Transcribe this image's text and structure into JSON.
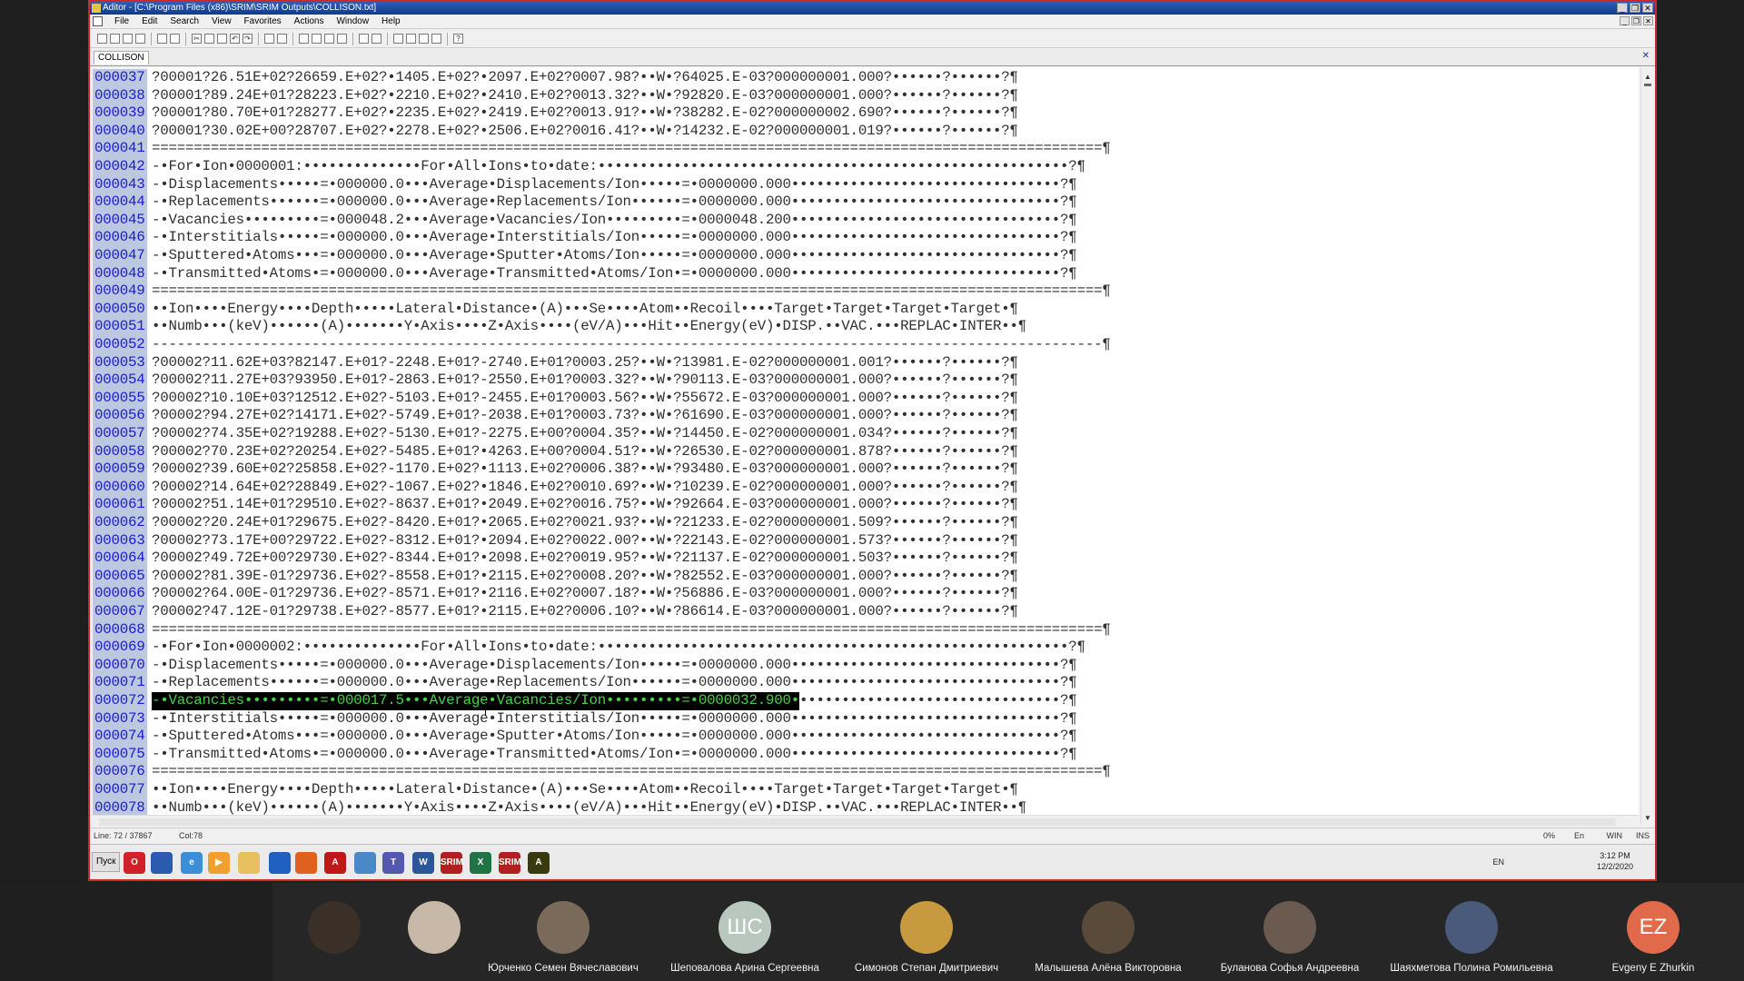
{
  "window": {
    "title": "Aditor - [C:\\Program Files (x86)\\SRIM\\SRIM Outputs\\COLLISON.txt]",
    "controls": [
      "_",
      "❐",
      "✕"
    ]
  },
  "menu": [
    "File",
    "Edit",
    "Search",
    "View",
    "Favorites",
    "Actions",
    "Window",
    "Help"
  ],
  "tab": {
    "label": "COLLISON",
    "close": "✕"
  },
  "editor": {
    "lines": [
      {
        "n": "000037",
        "t": "?00001?26.51E+02?26659.E+02?•1405.E+02?•2097.E+02?0007.98?••W•?64025.E-03?000000001.000?••••••?••••••?¶"
      },
      {
        "n": "000038",
        "t": "?00001?89.24E+01?28223.E+02?•2210.E+02?•2410.E+02?0013.32?••W•?92820.E-03?000000001.000?••••••?••••••?¶"
      },
      {
        "n": "000039",
        "t": "?00001?80.70E+01?28277.E+02?•2235.E+02?•2419.E+02?0013.91?••W•?38282.E-02?000000002.690?••••••?••••••?¶"
      },
      {
        "n": "000040",
        "t": "?00001?30.02E+00?28707.E+02?•2278.E+02?•2506.E+02?0016.41?••W•?14232.E-02?000000001.019?••••••?••••••?¶"
      },
      {
        "n": "000041",
        "t": "=================================================================================================================¶"
      },
      {
        "n": "000042",
        "t": "-•For•Ion•0000001:••••••••••••••For•All•Ions•to•date:••••••••••••••••••••••••••••••••••••••••••••••••••••••••?¶"
      },
      {
        "n": "000043",
        "t": "-•Displacements•••••=•000000.0•••Average•Displacements/Ion•••••=•0000000.000••••••••••••••••••••••••••••••••?¶"
      },
      {
        "n": "000044",
        "t": "-•Replacements••••••=•000000.0•••Average•Replacements/Ion••••••=•0000000.000••••••••••••••••••••••••••••••••?¶"
      },
      {
        "n": "000045",
        "t": "-•Vacancies•••••••••=•000048.2•••Average•Vacancies/Ion•••••••••=•0000048.200••••••••••••••••••••••••••••••••?¶"
      },
      {
        "n": "000046",
        "t": "-•Interstitials•••••=•000000.0•••Average•Interstitials/Ion•••••=•0000000.000••••••••••••••••••••••••••••••••?¶"
      },
      {
        "n": "000047",
        "t": "-•Sputtered•Atoms•••=•000000.0•••Average•Sputter•Atoms/Ion•••••=•0000000.000••••••••••••••••••••••••••••••••?¶"
      },
      {
        "n": "000048",
        "t": "-•Transmitted•Atoms•=•000000.0•••Average•Transmitted•Atoms/Ion•=•0000000.000••••••••••••••••••••••••••••••••?¶"
      },
      {
        "n": "000049",
        "t": "=================================================================================================================¶"
      },
      {
        "n": "000050",
        "t": "••Ion••••Energy••••Depth•••••Lateral•Distance•(A)•••Se••••Atom••Recoil••••Target•Target•Target•Target•¶"
      },
      {
        "n": "000051",
        "t": "••Numb•••(keV)••••••(A)•••••••Y•Axis••••Z•Axis••••(eV/A)•••Hit••Energy(eV)•DISP.••VAC.•••REPLAC•INTER••¶"
      },
      {
        "n": "000052",
        "t": "-----------------------------------------------------------------------------------------------------------------¶"
      },
      {
        "n": "000053",
        "t": "?00002?11.62E+03?82147.E+01?-2248.E+01?-2740.E+01?0003.25?••W•?13981.E-02?000000001.001?••••••?••••••?¶"
      },
      {
        "n": "000054",
        "t": "?00002?11.27E+03?93950.E+01?-2863.E+01?-2550.E+01?0003.32?••W•?90113.E-03?000000001.000?••••••?••••••?¶"
      },
      {
        "n": "000055",
        "t": "?00002?10.10E+03?12512.E+02?-5103.E+01?-2455.E+01?0003.56?••W•?55672.E-03?000000001.000?••••••?••••••?¶"
      },
      {
        "n": "000056",
        "t": "?00002?94.27E+02?14171.E+02?-5749.E+01?-2038.E+01?0003.73?••W•?61690.E-03?000000001.000?••••••?••••••?¶"
      },
      {
        "n": "000057",
        "t": "?00002?74.35E+02?19288.E+02?-5130.E+01?-2275.E+00?0004.35?••W•?14450.E-02?000000001.034?••••••?••••••?¶"
      },
      {
        "n": "000058",
        "t": "?00002?70.23E+02?20254.E+02?-5485.E+01?•4263.E+00?0004.51?••W•?26530.E-02?000000001.878?••••••?••••••?¶"
      },
      {
        "n": "000059",
        "t": "?00002?39.60E+02?25858.E+02?-1170.E+02?•1113.E+02?0006.38?••W•?93480.E-03?000000001.000?••••••?••••••?¶"
      },
      {
        "n": "000060",
        "t": "?00002?14.64E+02?28849.E+02?-1067.E+02?•1846.E+02?0010.69?••W•?10239.E-02?000000001.000?••••••?••••••?¶"
      },
      {
        "n": "000061",
        "t": "?00002?51.14E+01?29510.E+02?-8637.E+01?•2049.E+02?0016.75?••W•?92664.E-03?000000001.000?••••••?••••••?¶"
      },
      {
        "n": "000062",
        "t": "?00002?20.24E+01?29675.E+02?-8420.E+01?•2065.E+02?0021.93?••W•?21233.E-02?000000001.509?••••••?••••••?¶"
      },
      {
        "n": "000063",
        "t": "?00002?73.17E+00?29722.E+02?-8312.E+01?•2094.E+02?0022.00?••W•?22143.E-02?000000001.573?••••••?••••••?¶"
      },
      {
        "n": "000064",
        "t": "?00002?49.72E+00?29730.E+02?-8344.E+01?•2098.E+02?0019.95?••W•?21137.E-02?000000001.503?••••••?••••••?¶"
      },
      {
        "n": "000065",
        "t": "?00002?81.39E-01?29736.E+02?-8558.E+01?•2115.E+02?0008.20?••W•?82552.E-03?000000001.000?••••••?••••••?¶"
      },
      {
        "n": "000066",
        "t": "?00002?64.00E-01?29736.E+02?-8571.E+01?•2116.E+02?0007.18?••W•?56886.E-03?000000001.000?••••••?••••••?¶"
      },
      {
        "n": "000067",
        "t": "?00002?47.12E-01?29738.E+02?-8577.E+01?•2115.E+02?0006.10?••W•?86614.E-03?000000001.000?••••••?••••••?¶"
      },
      {
        "n": "000068",
        "t": "=================================================================================================================¶"
      },
      {
        "n": "000069",
        "t": "-•For•Ion•0000002:••••••••••••••For•All•Ions•to•date:••••••••••••••••••••••••••••••••••••••••••••••••••••••••?¶"
      },
      {
        "n": "000070",
        "t": "-•Displacements•••••=•000000.0•••Average•Displacements/Ion•••••=•0000000.000••••••••••••••••••••••••••••••••?¶"
      },
      {
        "n": "000071",
        "t": "-•Replacements••••••=•000000.0•••Average•Replacements/Ion••••••=•0000000.000••••••••••••••••••••••••••••••••?¶"
      },
      {
        "n": "000072",
        "t": "-•Vacancies•••••••••=•000017.5•••Average•Vacancies/Ion•••••••••=•0000032.900•",
        "t2": "•••••••••••••••••••••••••••••••?¶",
        "hl": true
      },
      {
        "n": "000073",
        "t": "-•Interstitials•••••=•000000.0•••Average•Interstitials/Ion•••••=•0000000.000••••••••••••••••••••••••••••••••?¶"
      },
      {
        "n": "000074",
        "t": "-•Sputtered•Atoms•••=•000000.0•••Average•Sputter•Atoms/Ion•••••=•0000000.000••••••••••••••••••••••••••••••••?¶"
      },
      {
        "n": "000075",
        "t": "-•Transmitted•Atoms•=•000000.0•••Average•Transmitted•Atoms/Ion•=•0000000.000••••••••••••••••••••••••••••••••?¶"
      },
      {
        "n": "000076",
        "t": "=================================================================================================================¶"
      },
      {
        "n": "000077",
        "t": "••Ion••••Energy••••Depth•••••Lateral•Distance•(A)•••Se••••Atom••Recoil••••Target•Target•Target•Target•¶"
      },
      {
        "n": "000078",
        "t": "••Numb•••(keV)••••••(A)•••••••Y•Axis••••Z•Axis••••(eV/A)•••Hit••Energy(eV)•DISP.••VAC.•••REPLAC•INTER••¶"
      }
    ]
  },
  "status": {
    "line": "Line: 72 / 37867",
    "col": "Col:78",
    "percent": "0%",
    "lang": "En",
    "mode": "WIN",
    "ins": "INS"
  },
  "taskbar": {
    "start": "Пуск",
    "apps": [
      {
        "icon": "opera-icon",
        "label": "O",
        "color": "#d0202a"
      },
      {
        "icon": "save-disk-icon",
        "label": "",
        "color": "#2a5bb0"
      },
      {
        "icon": "ie-icon",
        "label": "e",
        "color": "#3a8fd8"
      },
      {
        "icon": "media-player-icon",
        "label": "▶",
        "color": "#f0a030"
      },
      {
        "icon": "folder-icon",
        "label": "",
        "color": "#e8c060"
      },
      {
        "icon": "browser-icon",
        "label": "",
        "color": "#2060c0"
      },
      {
        "icon": "firefox-icon",
        "label": "",
        "color": "#e06020"
      },
      {
        "icon": "acrobat-icon",
        "label": "A",
        "color": "#c01818"
      },
      {
        "icon": "remote-icon",
        "label": "",
        "color": "#4a88c8"
      },
      {
        "icon": "teams-icon",
        "label": "T",
        "color": "#5558af"
      },
      {
        "icon": "word-icon",
        "label": "W",
        "color": "#2b579a"
      },
      {
        "icon": "srim-icon",
        "label": "SRIM",
        "color": "#b02020"
      },
      {
        "icon": "excel-icon",
        "label": "X",
        "color": "#217346"
      },
      {
        "icon": "srim-icon",
        "label": "SRIM",
        "color": "#b02020"
      },
      {
        "icon": "aditor-icon",
        "label": "A",
        "color": "#3a3a10"
      }
    ],
    "tray_lang": "EN",
    "time": "3:12 PM",
    "date": "12/2/2020"
  },
  "participants": [
    {
      "name": "",
      "avatar": "photo",
      "color": "#3a3028"
    },
    {
      "name": "",
      "avatar": "photo",
      "color": "#c8b8a8"
    },
    {
      "name": "Юрченко Семен Вячеславович",
      "avatar": "photo",
      "color": "#7a6a5a"
    },
    {
      "name": "Шеповалова Арина Сергеевна",
      "avatar": "initials",
      "initials": "ШС",
      "color": "#b8c8c0"
    },
    {
      "name": "Симонов Степан Дмитриевич",
      "avatar": "photo",
      "color": "#c89a40"
    },
    {
      "name": "Малышева Алёна Викторовна",
      "avatar": "photo",
      "color": "#5a4a3a"
    },
    {
      "name": "Буланова Софья Андреевна",
      "avatar": "photo",
      "color": "#6a5a50"
    },
    {
      "name": "Шаяхметова Полина Ромильевна",
      "avatar": "photo",
      "color": "#4a5a7a"
    },
    {
      "name": "Evgeny E Zhurkin",
      "avatar": "initials",
      "initials": "EZ",
      "color": "#e06a4a"
    }
  ]
}
